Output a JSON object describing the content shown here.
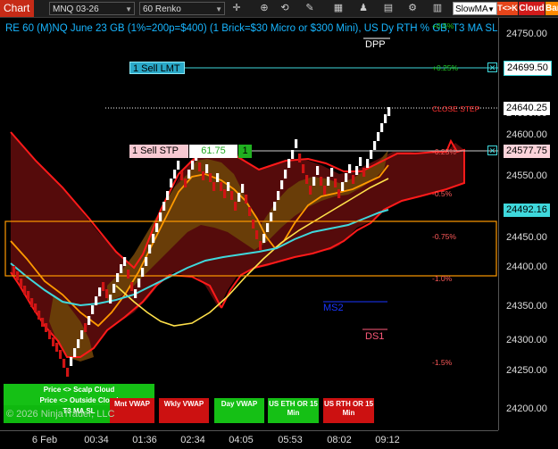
{
  "toolbar": {
    "tab_label": "Chart",
    "instrument": "MNQ 03-26",
    "bar_type": "60 Renko",
    "indicator": "SlowMA",
    "tck_label": "T<>K",
    "cloud_label": "Cloud",
    "bar_label": "Bar",
    "icons": [
      "crosshair-icon",
      "zoom-icon",
      "sync-icon",
      "drawing-tools-icon",
      "template-icon",
      "strategy-icon",
      "data-box-icon",
      "properties-icon",
      "chart-trader-icon"
    ]
  },
  "chart": {
    "title": "RE 60 (M)NQ June 23 GB (1%=200p=$400) (1 Brick=$30 Micro or $300 Mini), US Dy RTH % GB, T3 MA SL",
    "copyright": "© 2026 NinjaTrader, LLC",
    "dpp_label": "DPP",
    "ms2_label": "MS2",
    "ds1_label": "DS1",
    "close_label": "CLOSE STEP",
    "levels": [
      {
        "label": "+0.5%",
        "color": "#22cc22"
      },
      {
        "label": "+0.25%",
        "color": "#22cc22"
      },
      {
        "label": "-0.25%",
        "color": "#ff5a5a"
      },
      {
        "label": "-0.5%",
        "color": "#ff5a5a"
      },
      {
        "label": "-0.75%",
        "color": "#ff5a5a"
      },
      {
        "label": "-1.0%",
        "color": "#ff5a5a"
      },
      {
        "label": "-1.5%",
        "color": "#ff5a5a"
      }
    ]
  },
  "orders": {
    "sell_lmt": {
      "label": "1 Sell LMT",
      "price": "24699.50"
    },
    "sell_stp": {
      "label": "1 Sell STP",
      "entry": "61.75",
      "qty": "1",
      "price": "24577.75"
    }
  },
  "price_axis": {
    "ticks": [
      "24750.00",
      "24700.00",
      "24650.00",
      "24600.00",
      "24550.00",
      "24500.00",
      "24450.00",
      "24400.00",
      "24350.00",
      "24300.00",
      "24250.00",
      "24200.00"
    ],
    "current_price": "24640.25",
    "cyan_ma_price": "24492.16"
  },
  "time_axis": {
    "ticks": [
      "6 Feb",
      "00:34",
      "01:36",
      "02:34",
      "04:05",
      "05:53",
      "08:02",
      "09:12"
    ]
  },
  "buttons": {
    "scalp": "Price <> Scalp Cloud",
    "outside": "Price <> Outside Cloud",
    "t3": "T3 MA SL",
    "mnt_vwap": "Mnt VWAP",
    "wkly_vwap": "Wkly VWAP",
    "day_vwap": "Day VWAP",
    "us_eth": "US ETH OR 15 Min",
    "us_rth": "US RTH OR 15 Min"
  },
  "colors": {
    "cloud_red": "#5a0c0c",
    "cloud_orange": "#6a4008",
    "red_line": "#ff1a1a",
    "orange_line": "#ff9a00",
    "yellow_ma": "#ffe14a",
    "cyan_ma": "#3fd8dc",
    "up_brick": "#ffffff",
    "down_brick": "#d01414"
  }
}
